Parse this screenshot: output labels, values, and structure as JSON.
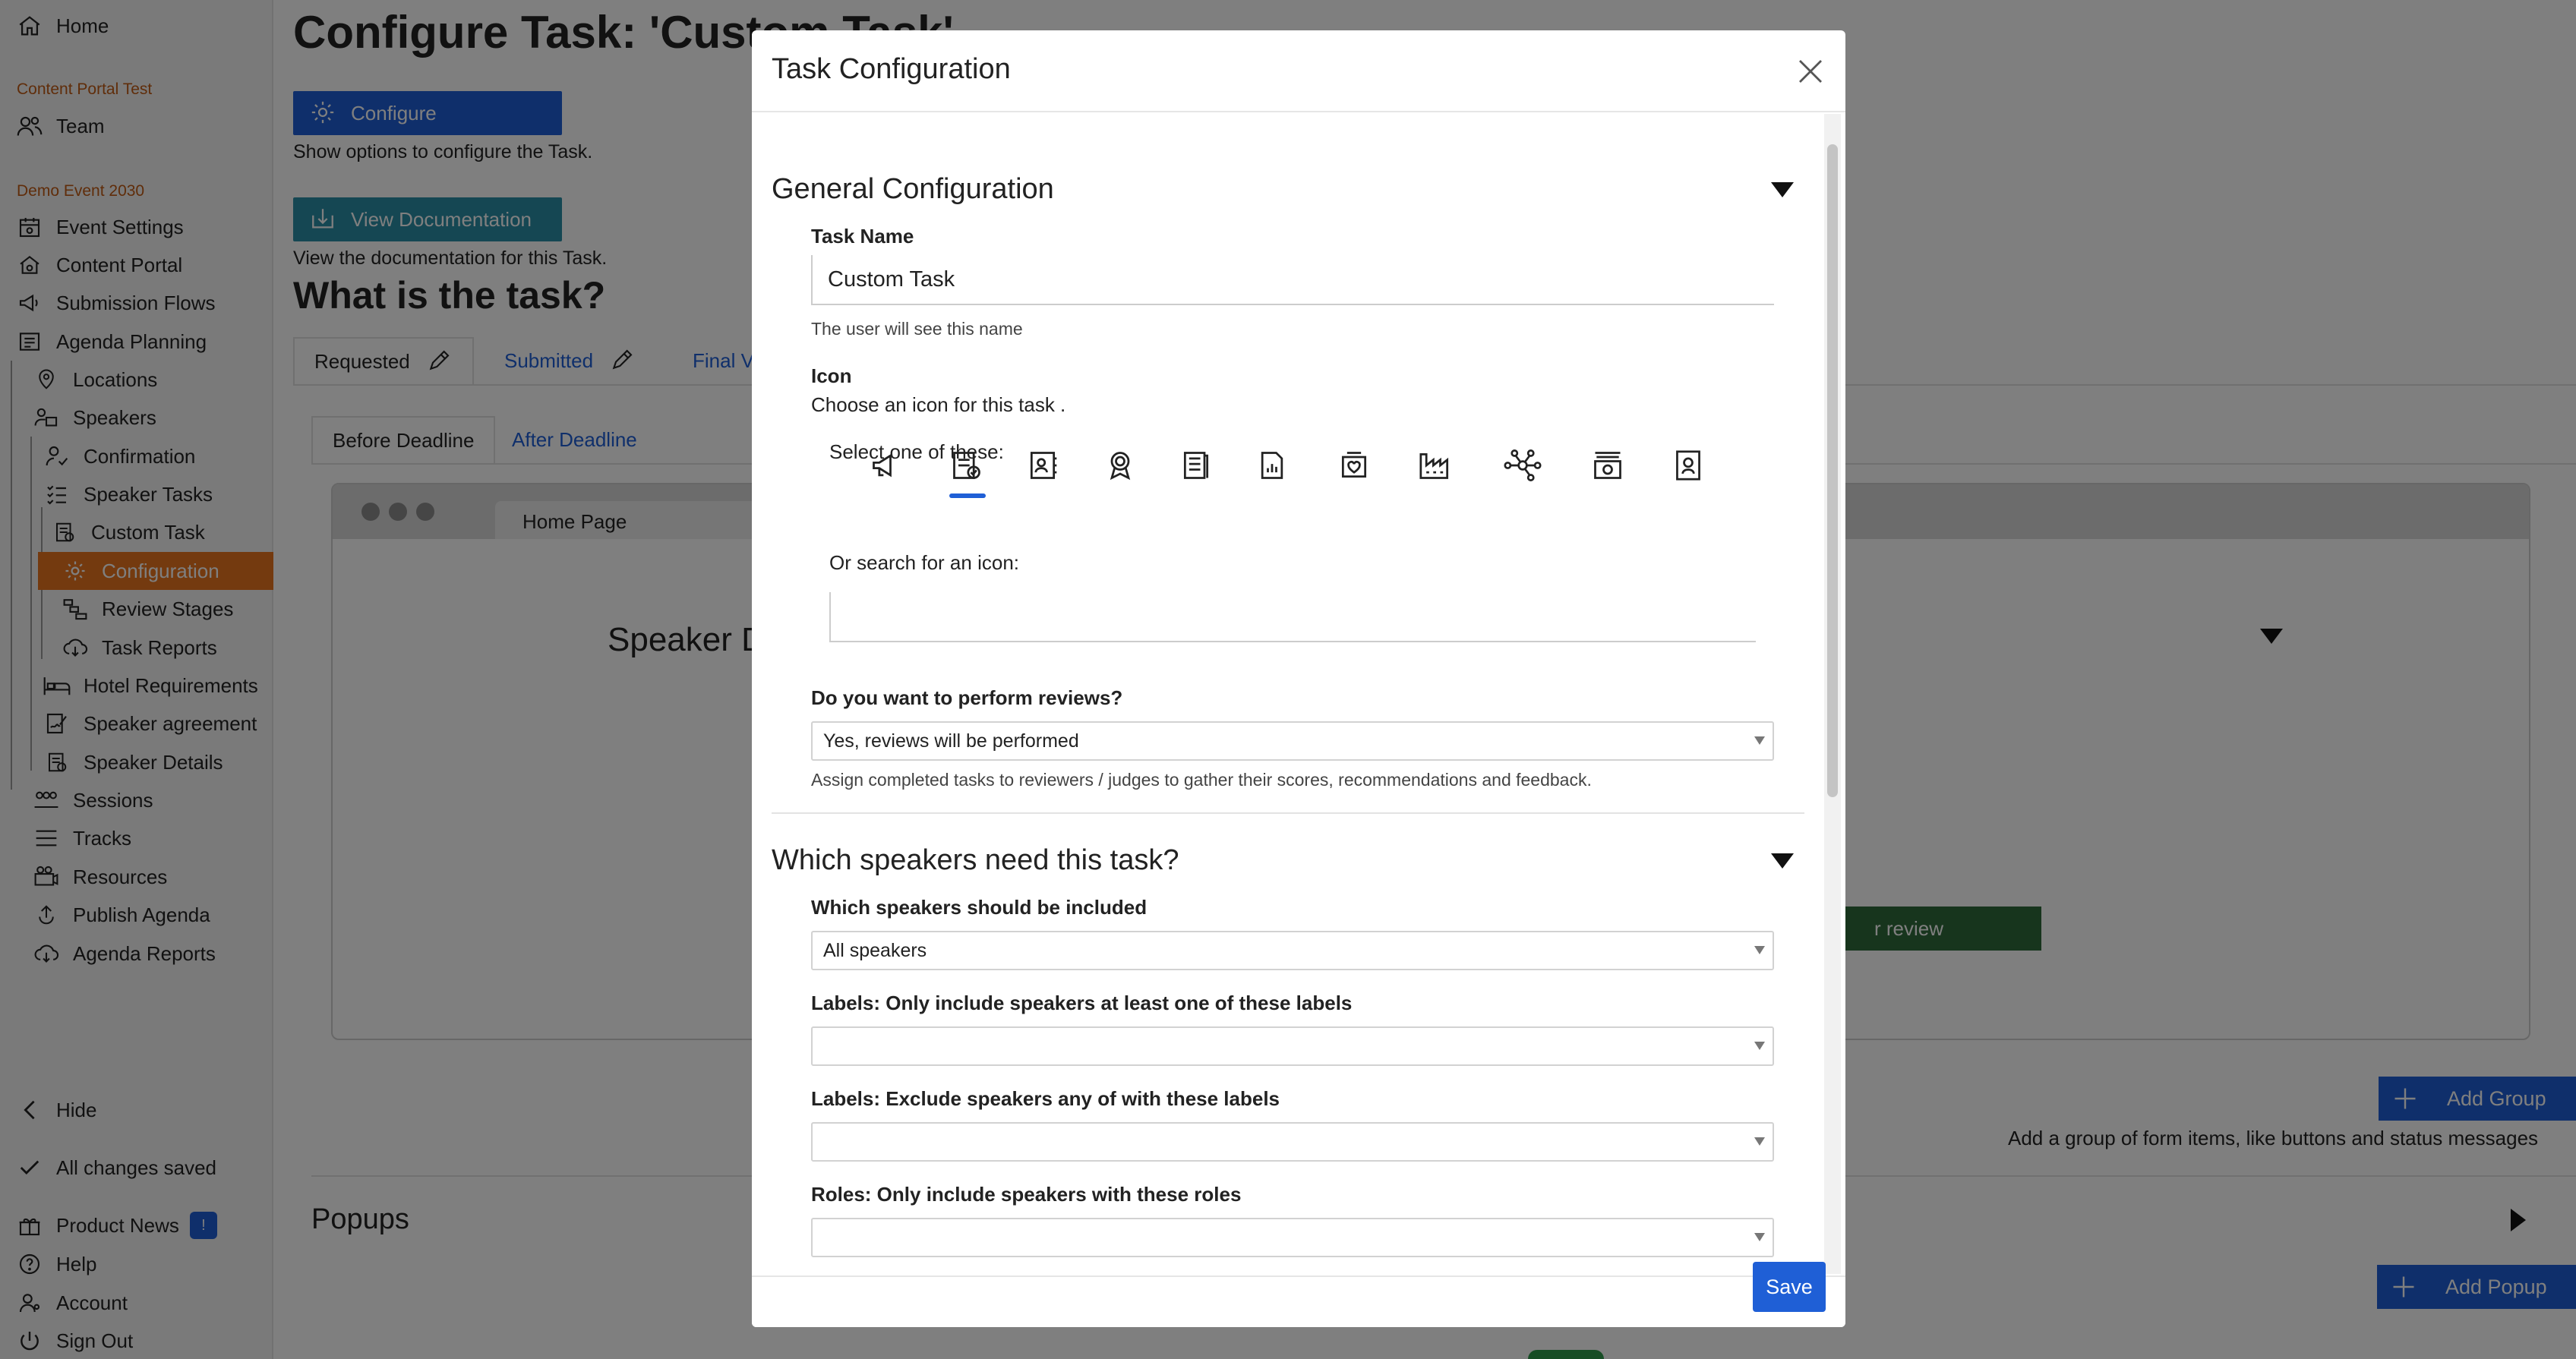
{
  "sidebar": {
    "home": "Home",
    "org_section": "Content Portal Test",
    "team": "Team",
    "event_section": "Demo Event 2030",
    "items": [
      {
        "label": "Event Settings",
        "icon": "calendar-gear-icon"
      },
      {
        "label": "Content Portal",
        "icon": "home-gear-icon"
      },
      {
        "label": "Submission Flows",
        "icon": "megaphone-icon"
      },
      {
        "label": "Agenda Planning",
        "icon": "agenda-list-icon"
      },
      {
        "label": "Locations",
        "icon": "location-pin-icon"
      },
      {
        "label": "Speakers",
        "icon": "speaker-icon"
      },
      {
        "label": "Confirmation",
        "icon": "user-check-icon"
      },
      {
        "label": "Speaker Tasks",
        "icon": "task-list-icon"
      },
      {
        "label": "Custom Task",
        "icon": "task-doc-icon"
      },
      {
        "label": "Configuration",
        "icon": "gear-icon"
      },
      {
        "label": "Review Stages",
        "icon": "stages-icon"
      },
      {
        "label": "Task Reports",
        "icon": "cloud-download-icon"
      },
      {
        "label": "Hotel Requirements",
        "icon": "bed-icon"
      },
      {
        "label": "Speaker agreement",
        "icon": "signature-icon"
      },
      {
        "label": "Speaker Details",
        "icon": "details-doc-icon"
      },
      {
        "label": "Sessions",
        "icon": "people-icon"
      },
      {
        "label": "Tracks",
        "icon": "tracks-icon"
      },
      {
        "label": "Resources",
        "icon": "resources-icon"
      },
      {
        "label": "Publish Agenda",
        "icon": "publish-icon"
      },
      {
        "label": "Agenda Reports",
        "icon": "cloud-download-icon"
      }
    ],
    "hide": "Hide",
    "saved": "All changes saved",
    "product_news": "Product News",
    "product_news_badge": "!",
    "help": "Help",
    "account": "Account",
    "sign_out": "Sign Out"
  },
  "main": {
    "title": "Configure Task: 'Custom Task'",
    "configure_button": "Configure",
    "configure_help": "Show options to configure the Task.",
    "docs_button": "View Documentation",
    "docs_help": "View the documentation for this Task.",
    "what_is_task": "What is the task?",
    "tabs": [
      "Requested",
      "Submitted",
      "Final V"
    ],
    "subtabs": [
      "Before Deadline",
      "After Deadline"
    ],
    "browser_tab": "Home Page",
    "speaker_detail": "Speaker Detai",
    "review_button": "r review",
    "add_group": "Add Group",
    "add_group_help": "Add a group of form items, like buttons and status messages",
    "popups": "Popups",
    "add_popup": "Add Popup"
  },
  "modal": {
    "title": "Task Configuration",
    "general": {
      "title": "General Configuration",
      "task_name_label": "Task Name",
      "task_name_value": "Custom Task",
      "task_name_help": "The user will see this name",
      "icon_label": "Icon",
      "icon_help": "Choose an icon for this task .",
      "select_one": "Select one of these:",
      "icons": [
        "megaphone-icon",
        "document-check-icon",
        "contact-card-icon",
        "award-badge-icon",
        "book-icon",
        "document-chart-icon",
        "heart-box-icon",
        "factory-icon",
        "network-icon",
        "archive-icon",
        "id-badge-icon"
      ],
      "search_label": "Or search for an icon:",
      "search_value": "",
      "reviews_label": "Do you want to perform reviews?",
      "reviews_value": "Yes, reviews will be performed",
      "reviews_help": "Assign completed tasks to reviewers / judges to gather their scores, recommendations and feedback."
    },
    "speakers": {
      "title": "Which speakers need this task?",
      "include_label": "Which speakers should be included",
      "include_value": "All speakers",
      "labels_include_label": "Labels: Only include speakers at least one of these labels",
      "labels_include_value": "",
      "labels_exclude_label": "Labels: Exclude speakers any of with these labels",
      "labels_exclude_value": "",
      "roles_label": "Roles: Only include speakers with these roles",
      "roles_value": ""
    },
    "save": "Save"
  },
  "colors": {
    "accent_orange": "#e8751f",
    "primary_blue": "#1f5fd6",
    "docs_teal": "#2a8ea6",
    "green": "#2e6b3a"
  }
}
